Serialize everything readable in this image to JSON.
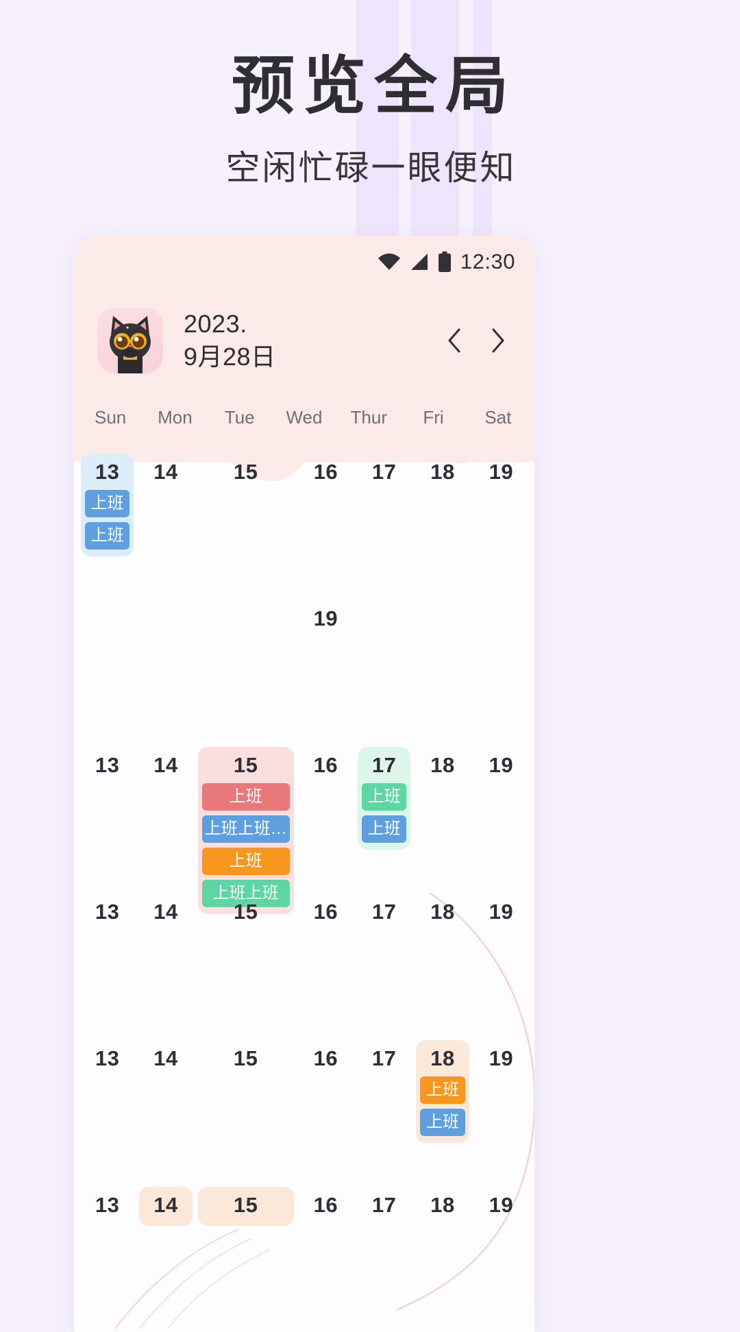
{
  "hero": {
    "title": "预览全局",
    "subtitle": "空闲忙碌一眼便知"
  },
  "colors": {
    "page_bg": "#f6f1fd",
    "stripe": "#ece2fa",
    "phone_bg": "#fdfcfe",
    "header_pink": "#fbeae7",
    "chip_blue": "#5f9fe0",
    "chip_red": "#ea7878",
    "chip_orange": "#f7971e",
    "chip_green": "#5ed6a4",
    "cell_blue_bg": "#dcecf9",
    "cell_pink_bg": "#fbdfdf",
    "cell_green_bg": "#dcf6ea",
    "cell_peach_bg": "#fce8d8"
  },
  "statusbar": {
    "wifi_icon": "wifi-icon",
    "signal_icon": "signal-icon",
    "battery_icon": "battery-icon",
    "time": "12:30"
  },
  "header": {
    "avatar_icon": "cat-avatar",
    "year_line": "2023.",
    "date_line": "9月28日",
    "prev_icon": "chevron-left-icon",
    "next_icon": "chevron-right-icon"
  },
  "weekdays": [
    "Sun",
    "Mon",
    "Tue",
    "Wed",
    "Thur",
    "Fri",
    "Sat"
  ],
  "calendar": {
    "rows": [
      [
        {
          "day": "13",
          "cell_bg": "#dcecf9",
          "events": [
            {
              "label": "上班",
              "color": "#5f9fe0"
            },
            {
              "label": "上班",
              "color": "#5f9fe0"
            }
          ]
        },
        {
          "day": "14",
          "cell_bg": "",
          "events": []
        },
        {
          "day": "15",
          "cell_bg": "",
          "events": []
        },
        {
          "day": "16",
          "cell_bg": "",
          "events": []
        },
        {
          "day": "17",
          "cell_bg": "",
          "events": []
        },
        {
          "day": "18",
          "cell_bg": "",
          "events": []
        },
        {
          "day": "19",
          "cell_bg": "",
          "events": []
        }
      ],
      [
        {
          "day": "",
          "cell_bg": "",
          "events": []
        },
        {
          "day": "",
          "cell_bg": "",
          "events": []
        },
        {
          "day": "",
          "cell_bg": "",
          "events": []
        },
        {
          "day": "19",
          "cell_bg": "",
          "events": []
        },
        {
          "day": "",
          "cell_bg": "",
          "events": []
        },
        {
          "day": "",
          "cell_bg": "",
          "events": []
        },
        {
          "day": "",
          "cell_bg": "",
          "events": []
        }
      ],
      [
        {
          "day": "13",
          "cell_bg": "",
          "events": []
        },
        {
          "day": "14",
          "cell_bg": "",
          "events": []
        },
        {
          "day": "15",
          "cell_bg": "#fbdfdf",
          "events": [
            {
              "label": "上班",
              "color": "#ea7878"
            },
            {
              "label": "上班上班…",
              "color": "#5f9fe0"
            },
            {
              "label": "上班",
              "color": "#f7971e"
            },
            {
              "label": "上班上班",
              "color": "#5ed6a4"
            }
          ]
        },
        {
          "day": "16",
          "cell_bg": "",
          "events": []
        },
        {
          "day": "17",
          "cell_bg": "#dcf6ea",
          "events": [
            {
              "label": "上班",
              "color": "#5ed6a4"
            },
            {
              "label": "上班",
              "color": "#5f9fe0"
            }
          ]
        },
        {
          "day": "18",
          "cell_bg": "",
          "events": []
        },
        {
          "day": "19",
          "cell_bg": "",
          "events": []
        }
      ],
      [
        {
          "day": "13",
          "cell_bg": "",
          "events": []
        },
        {
          "day": "14",
          "cell_bg": "",
          "events": []
        },
        {
          "day": "15",
          "cell_bg": "",
          "events": []
        },
        {
          "day": "16",
          "cell_bg": "",
          "events": []
        },
        {
          "day": "17",
          "cell_bg": "",
          "events": []
        },
        {
          "day": "18",
          "cell_bg": "",
          "events": []
        },
        {
          "day": "19",
          "cell_bg": "",
          "events": []
        }
      ],
      [
        {
          "day": "13",
          "cell_bg": "",
          "events": []
        },
        {
          "day": "14",
          "cell_bg": "",
          "events": []
        },
        {
          "day": "15",
          "cell_bg": "",
          "events": []
        },
        {
          "day": "16",
          "cell_bg": "",
          "events": []
        },
        {
          "day": "17",
          "cell_bg": "",
          "events": []
        },
        {
          "day": "18",
          "cell_bg": "#fce8d8",
          "events": [
            {
              "label": "上班",
              "color": "#f7971e"
            },
            {
              "label": "上班",
              "color": "#5f9fe0"
            }
          ]
        },
        {
          "day": "19",
          "cell_bg": "",
          "events": []
        }
      ],
      [
        {
          "day": "13",
          "cell_bg": "",
          "events": []
        },
        {
          "day": "14",
          "cell_bg": "#fce8d8",
          "events": []
        },
        {
          "day": "15",
          "cell_bg": "#fce8d8",
          "events": []
        },
        {
          "day": "16",
          "cell_bg": "",
          "events": []
        },
        {
          "day": "17",
          "cell_bg": "",
          "events": []
        },
        {
          "day": "18",
          "cell_bg": "",
          "events": []
        },
        {
          "day": "19",
          "cell_bg": "",
          "events": []
        }
      ]
    ]
  }
}
